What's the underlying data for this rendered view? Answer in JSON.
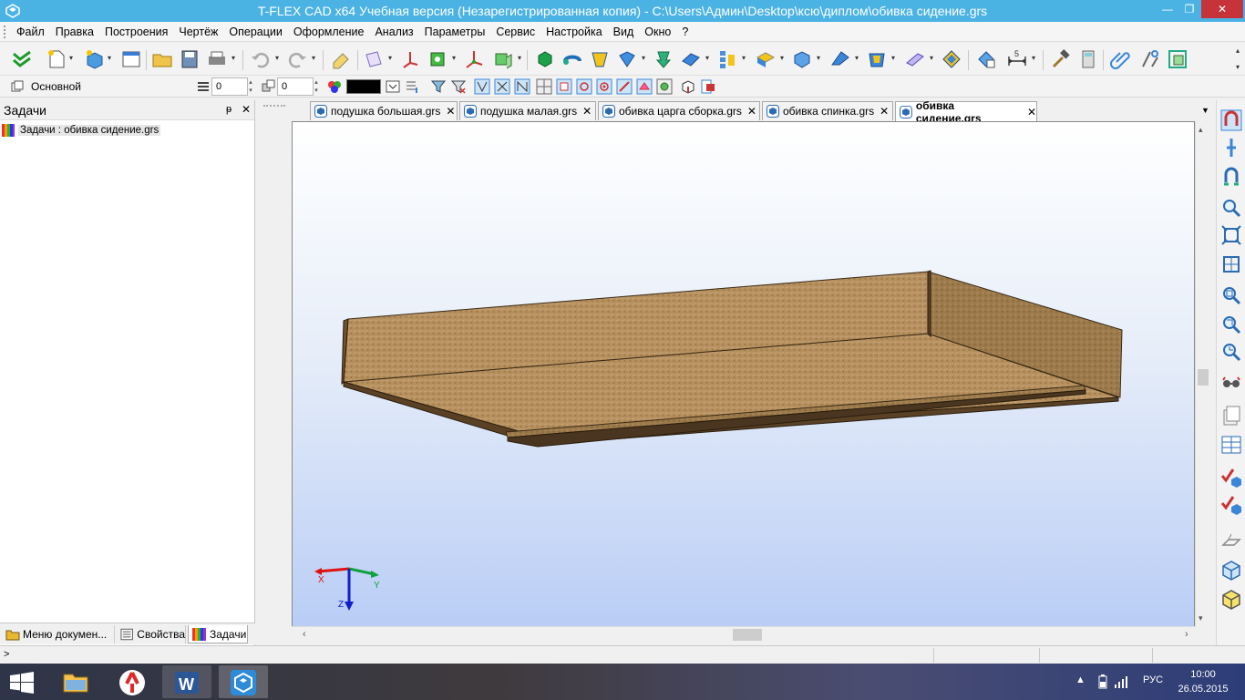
{
  "window": {
    "title": "T-FLEX CAD x64 Учебная версия (Незарегистрированная копия) - C:\\Users\\Админ\\Desktop\\ксю\\диплом\\обивка сидение.grs",
    "minimize": "—",
    "maximize": "❐",
    "close": "✕"
  },
  "menu": {
    "items": [
      "Файл",
      "Правка",
      "Построения",
      "Чертёж",
      "Операции",
      "Оформление",
      "Анализ",
      "Параметры",
      "Сервис",
      "Настройка",
      "Вид",
      "Окно",
      "?"
    ]
  },
  "toolbar2": {
    "layer_name": "Основной",
    "field1_value": "0",
    "field2_value": "0",
    "color_value": "#000000"
  },
  "tasks_panel": {
    "title": "Задачи",
    "pin": "ᵽ",
    "close": "✕",
    "item": "Задачи : обивка сидение.grs",
    "bottom_tabs": [
      {
        "label": "Меню докумен..."
      },
      {
        "label": "Свойства"
      },
      {
        "label": "Задачи"
      }
    ]
  },
  "doc_tabs": [
    {
      "label": "подушка большая.grs",
      "active": false
    },
    {
      "label": "подушка малая.grs",
      "active": false
    },
    {
      "label": "обивка царга сборка.grs",
      "active": false
    },
    {
      "label": "обивка спинка.grs",
      "active": false
    },
    {
      "label": "обивка сидение.grs",
      "active": true
    }
  ],
  "doc_tab_close": "✕",
  "axes": {
    "x": "X",
    "y": "Y",
    "z": "Z"
  },
  "statusbar": {
    "prompt": ">"
  },
  "taskbar": {
    "apps": [
      "file-explorer",
      "yandex-browser",
      "word",
      "t-flex-cad"
    ],
    "lang": "РУС",
    "time": "10:00",
    "date": "26.05.2015"
  },
  "colors": {
    "titlebar": "#4bb3e3",
    "close_button": "#c7333a",
    "model_fabric": "#b58f5e",
    "model_fabric_dark": "#8a6a43",
    "model_fabric_light": "#c9a679"
  }
}
